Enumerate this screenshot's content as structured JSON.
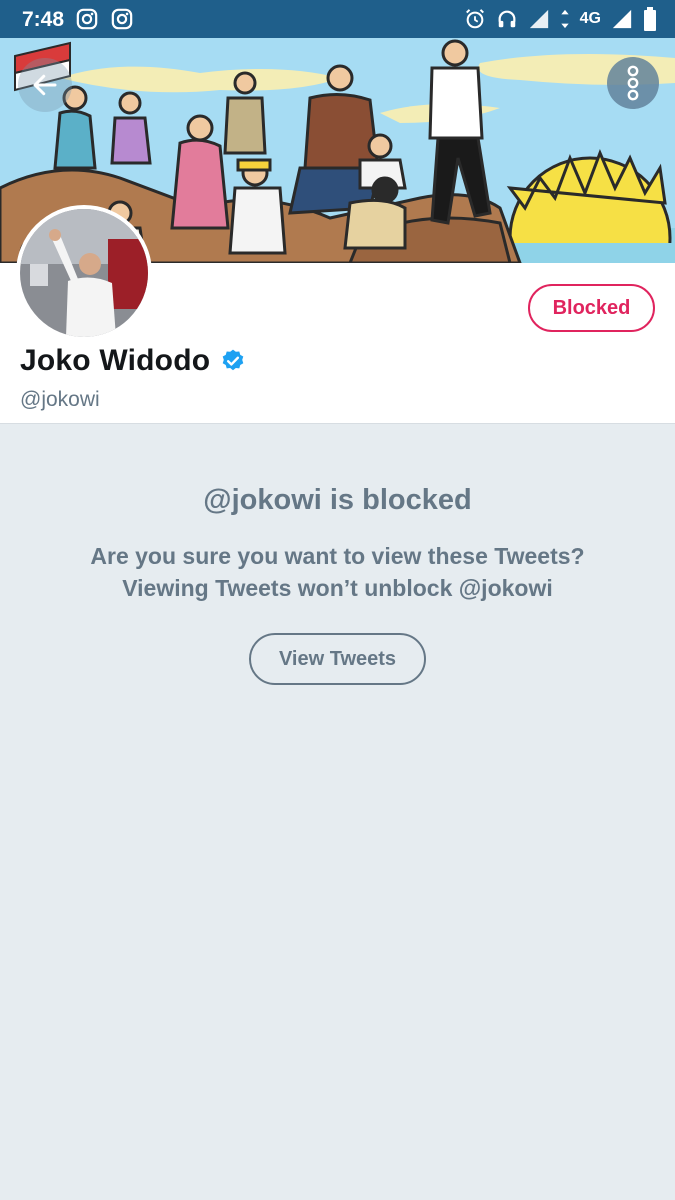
{
  "status_bar": {
    "time": "7:48",
    "left_icons": [
      "instagram-icon",
      "instagram-icon"
    ],
    "network": "4G",
    "right_icons": [
      "alarm-icon",
      "headphones-icon",
      "signal-icon",
      "battery-icon"
    ]
  },
  "header": {
    "back_icon": "arrow-left-icon",
    "more_icon": "more-vertical-icon"
  },
  "profile": {
    "display_name": "Joko Widodo",
    "verified": true,
    "handle": "@jokowi",
    "block_button_label": "Blocked"
  },
  "blocked_notice": {
    "title": "@jokowi is blocked",
    "line1": "Are you sure you want to view these Tweets?",
    "line2": "Viewing Tweets won’t unblock @jokowi",
    "button_label": "View Tweets"
  },
  "colors": {
    "status_bar": "#1f5f8b",
    "blocked_red": "#e0245e",
    "muted_gray": "#657786",
    "background": "#e6ecf0",
    "verified_blue": "#1da1f2"
  }
}
